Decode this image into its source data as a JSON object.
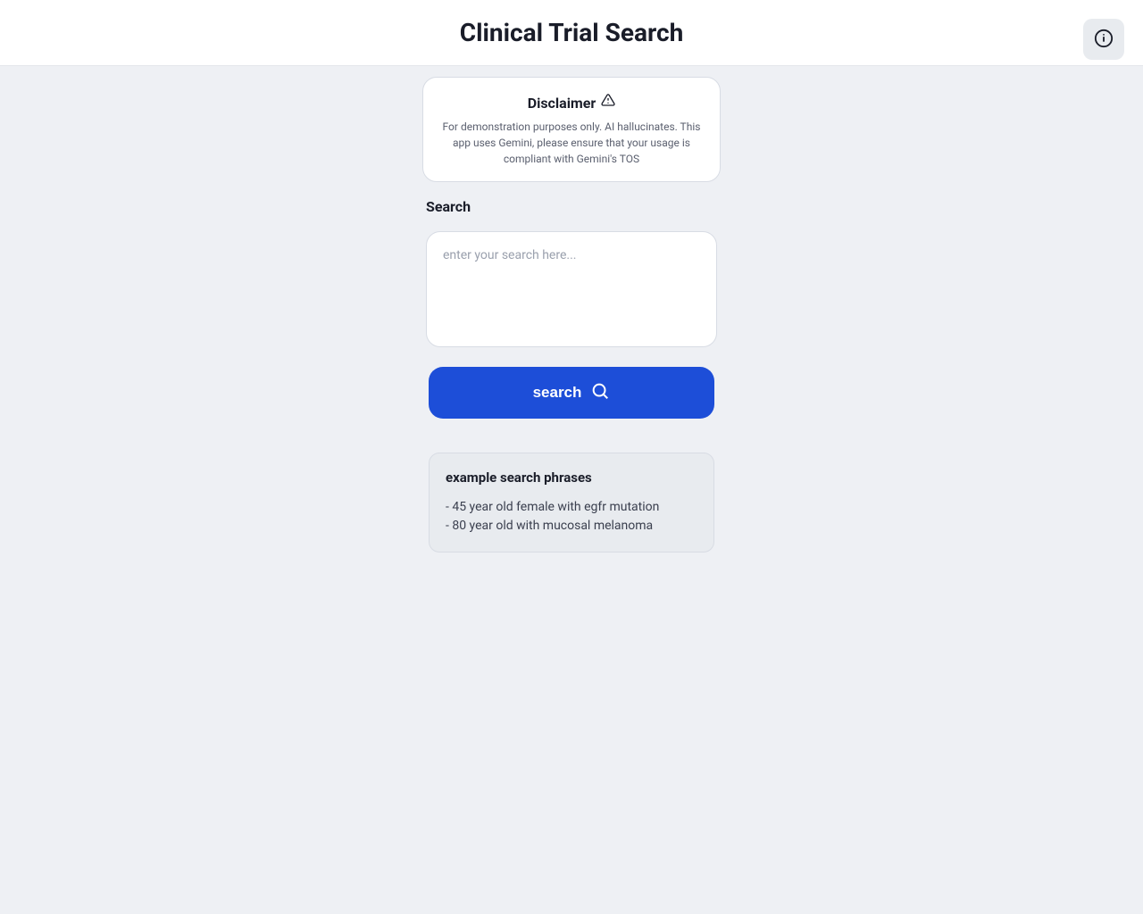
{
  "header": {
    "title": "Clinical Trial Search"
  },
  "disclaimer": {
    "title": "Disclaimer",
    "body": "For demonstration purposes only. AI hallucinates. This app uses Gemini, please ensure that your usage is compliant with Gemini's TOS"
  },
  "search": {
    "label": "Search",
    "placeholder": "enter your search here...",
    "value": "",
    "button_label": "search"
  },
  "examples": {
    "title": "example search phrases",
    "items": [
      "- 45 year old female with egfr mutation",
      "- 80 year old with mucosal melanoma"
    ]
  },
  "colors": {
    "primary": "#1d4ed8",
    "background": "#eef0f4",
    "card": "#ffffff",
    "muted_card": "#e8ebef",
    "text": "#1a1d29",
    "text_muted": "#5a5f6e",
    "border": "#d8dce4"
  }
}
